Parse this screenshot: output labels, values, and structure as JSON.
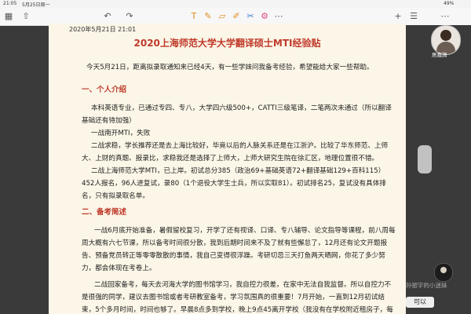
{
  "status": {
    "time": "21:05",
    "date": "5月25日周一",
    "battery": "49%"
  },
  "toolbar": {
    "icons": [
      "grid-icon",
      "share-icon",
      "undo-icon",
      "redo-icon",
      "text-icon",
      "pen-icon",
      "eraser-icon",
      "highlighter-icon",
      "lasso-icon",
      "shape-icon",
      "add-icon",
      "lines-icon",
      "more-icon"
    ]
  },
  "document": {
    "date": "2020年5月21日 21:01",
    "title": "2020上海师范大学大学翻译硕士MTI经验贴",
    "intro": "今天5月21日，距离拟录取通知来已经4天，有一些学妹问我备考经验，希望能给大家一些帮助。",
    "section1": "一、个人介绍",
    "p1": "本科英语专业，已通过专四、专八，大学四六级500+，CATTI三级笔译，二笔两次未通过（所以翻译基础还有待加强）",
    "p2": "一战南开MTI，失败",
    "p3": "二战求稳，学长推荐还是去上海比较好，毕竟以后的人脉关系还是在江浙沪。比较了华东师范、上师大、上财的真题、报录比，求稳我还是选择了上师大，上师大研究生院在徐汇区，地理位置很不错。",
    "p4": "二战上海师范大学MTI，已上岸。初试总分385（政治69+基础英语72+翻译基础129+百科115）452人报名，96人进复试，录80（1个退役大学生士兵，所以实取81）。初试排名25，复试没有具体排名，只有拟录取名单。",
    "section2": "二、备考简述",
    "p5": "一战6月底开始准备，暑假留校复习，开学了还有视译、口译、专八辅导、论文指导等课程，前八周每周大概有六七节课，所以备考时间很分散，我到后期时间来不及了就有些懈怠了，12月还有论文开题报告、预备党员转正等零零散散的事情，我自己变得很浮躁。考研切忌三天打鱼两天晒网，你花了多少努力，都会体现在考卷上。",
    "p6": "二战回家备考，每天去河海大学的图书馆学习，我自控力很差，在家中无法自我监督。所以自控力不是很强的同学，建议去图书馆或者考研教室备考，学习氛围真的很重要！7月开始，一直到12月初试结束，5个多月时间，时间也够了。早晨8点多到学校，晚上9点45离开学校（我没有在学校附近租房子，每天"
  },
  "meeting": {
    "name": "居嘉旖",
    "comment": "孙振宇的小迷妹",
    "reply": "可以"
  }
}
